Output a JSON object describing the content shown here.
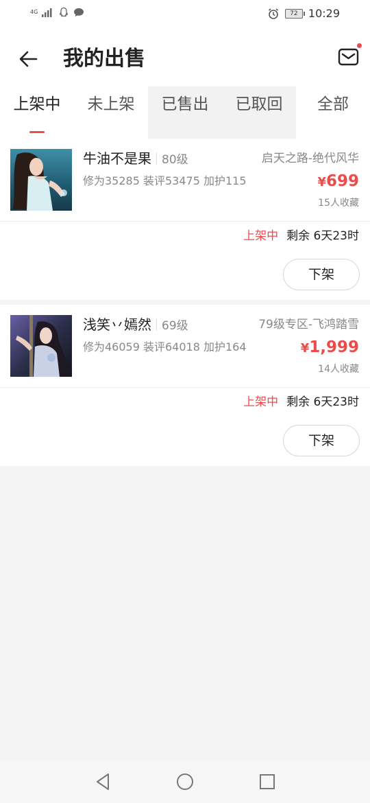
{
  "status_bar": {
    "network": "4G",
    "battery": "72",
    "time": "10:29"
  },
  "header": {
    "title": "我的出售"
  },
  "tabs": [
    {
      "label": "上架中",
      "active": true
    },
    {
      "label": "未上架",
      "active": false
    },
    {
      "label": "已售出",
      "active": false
    },
    {
      "label": "已取回",
      "active": false
    },
    {
      "label": "全部",
      "active": false
    }
  ],
  "listings": [
    {
      "name": "牛油不是果",
      "level": "80级",
      "stats": "修为35285 装评53475 加护115",
      "server": "启天之路-绝代风华",
      "price_symbol": "¥",
      "price": "699",
      "favorites": "15人收藏",
      "status": "上架中",
      "remaining": "剩余 6天23时",
      "action": "下架"
    },
    {
      "name": "浅笑丷嫣然",
      "level": "69级",
      "stats": "修为46059 装评64018 加护164",
      "server": "79级专区-飞鸿踏雪",
      "price_symbol": "¥",
      "price": "1,999",
      "favorites": "14人收藏",
      "status": "上架中",
      "remaining": "剩余 6天23时",
      "action": "下架"
    }
  ],
  "colors": {
    "accent": "#e84c4c",
    "background": "#f4f4f4",
    "text_primary": "#222222",
    "text_secondary": "#888888"
  },
  "icons": {
    "back": "arrow-left-icon",
    "mail": "mail-icon",
    "nav_back": "triangle-back-icon",
    "nav_home": "circle-home-icon",
    "nav_recent": "square-recent-icon"
  }
}
